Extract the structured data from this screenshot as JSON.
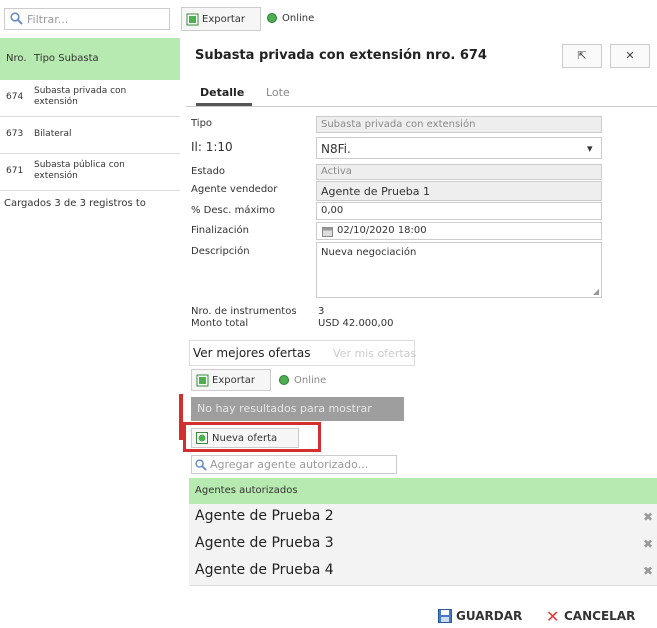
{
  "filter": {
    "placeholder": "Filtrar..."
  },
  "list": {
    "headers": [
      "Nro.",
      "Tipo Subasta"
    ],
    "rows": [
      {
        "num": "674",
        "name_line1": "Subasta privada con",
        "name_line2": "extensión"
      },
      {
        "num": "673",
        "name_line1": "Bilateral",
        "name_line2": ""
      },
      {
        "num": "671",
        "name_line1": "Subasta pública con",
        "name_line2": "extensión"
      }
    ],
    "loaded": "Cargados 3 de 3 registros to"
  },
  "toolbar": {
    "export_label": "Exportar",
    "online_label": "Online"
  },
  "panel": {
    "title": "Subasta privada con extensión nro. 674",
    "window_buttons": [
      "⇱",
      "✕"
    ],
    "tabs": [
      "Detalle",
      "Lote"
    ]
  },
  "form": {
    "tipo_label": "Tipo",
    "tipo_value": "Subasta privada con extensión",
    "row2_label": "Il: 1:10",
    "row2_value": "N8Fi.",
    "estado_label": "Estado",
    "estado_value": "Activa",
    "agente_label": "Agente vendedor",
    "agente_value": "Agente de Prueba 1",
    "desc_label": "% Desc. máximo",
    "desc_value": "0,00",
    "fin_label": "Finalización",
    "fin_value": "02/10/2020 18:00",
    "descripcion_label": "Descripción",
    "descripcion_value": "Nueva negociación",
    "instr_label": "Nro. de instrumentos",
    "instr_value": "3",
    "monto_label": "Monto total",
    "monto_value": "USD 42.000,00"
  },
  "offers": {
    "tab_best": "Ver mejores ofertas",
    "tab_mine": "Ver mis ofertas",
    "export_label": "Exportar",
    "online_label": "Online",
    "no_results": "No hay resultados para mostrar",
    "new_offer": "Nueva oferta"
  },
  "agents": {
    "search_placeholder": "Agregar agente autorizado...",
    "header": "Agentes autorizados",
    "rows": [
      "Agente de Prueba 2",
      "Agente de Prueba 3",
      "Agente de Prueba 4"
    ]
  },
  "footer": {
    "save": "GUARDAR",
    "cancel": "CANCELAR"
  },
  "colors": {
    "accent_green": "#b7eab0",
    "highlight_red": "#d32f2f",
    "online_green": "#4caf50"
  }
}
